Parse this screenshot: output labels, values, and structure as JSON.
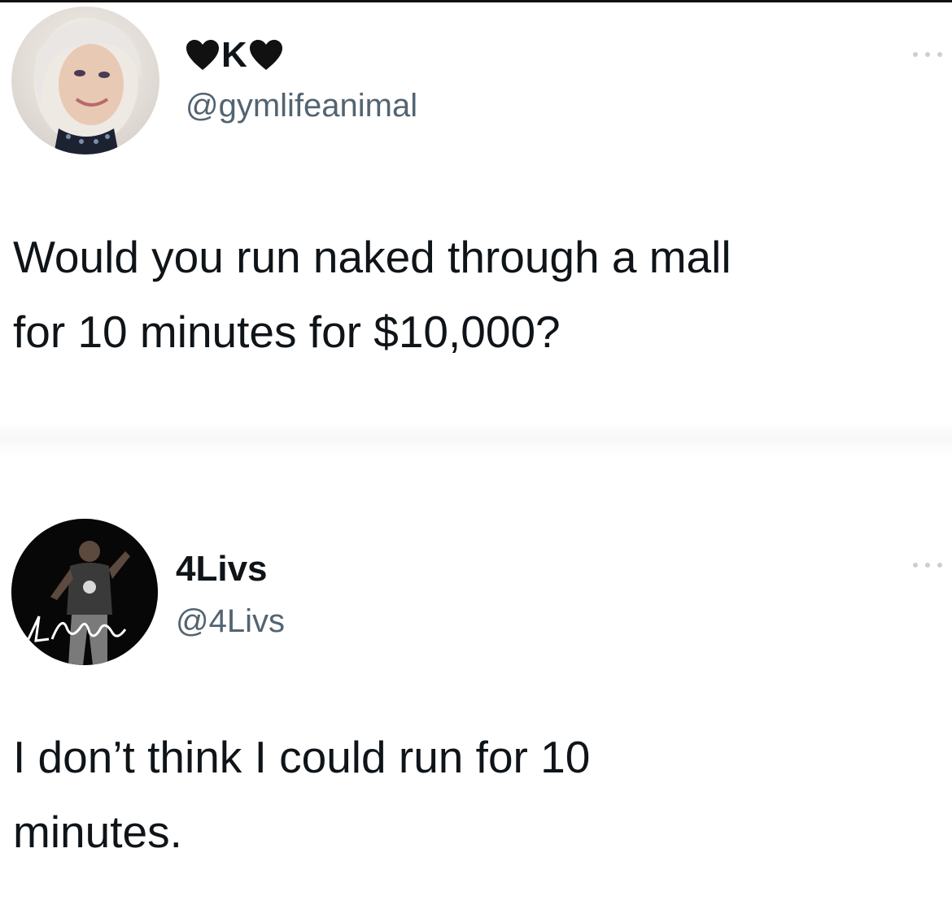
{
  "tweets": [
    {
      "name": "K",
      "name_decoration": "black-heart",
      "handle": "@gymlifeanimal",
      "text_line1": "Would you run naked through a mall",
      "text_line2": "for 10 minutes for $10,000?",
      "more_icon": "more-dots-icon"
    },
    {
      "name": "4Livs",
      "handle": "@4Livs",
      "avatar_signature": "4Livs",
      "text_line1": "I don’t think I could run for 10",
      "text_line2": "minutes.",
      "more_icon": "more-dots-icon"
    }
  ],
  "colors": {
    "text": "#0f1419",
    "secondary_text": "#536471",
    "background": "#ffffff",
    "heart": "#111111"
  }
}
